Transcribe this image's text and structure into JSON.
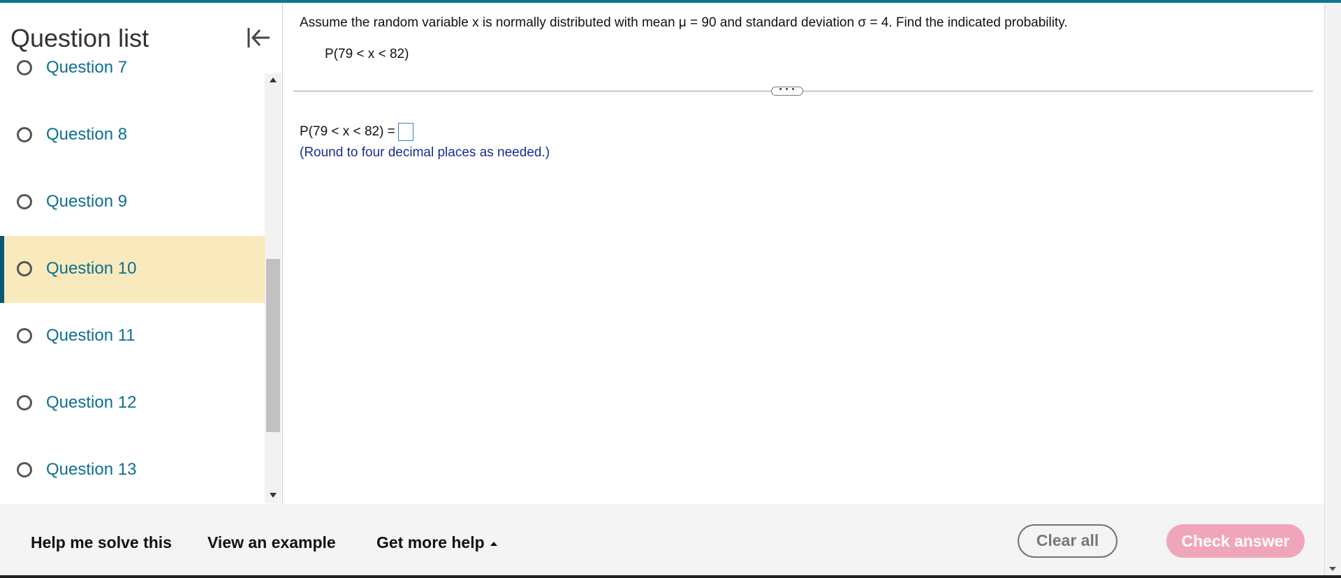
{
  "sidebar": {
    "title": "Question list",
    "collapse_icon": "collapse-left-icon",
    "items": [
      {
        "label": "Question 7"
      },
      {
        "label": "Question 8"
      },
      {
        "label": "Question 9"
      },
      {
        "label": "Question 10",
        "active": true
      },
      {
        "label": "Question 11"
      },
      {
        "label": "Question 12"
      },
      {
        "label": "Question 13"
      }
    ]
  },
  "question": {
    "text": "Assume the random variable x is normally distributed with mean μ = 90 and standard deviation σ = 4. Find the indicated probability.",
    "expression": "P(79 < x < 82)",
    "answer_prefix": "P(79 < x < 82) =",
    "answer_value": "",
    "hint": "(Round to four decimal places as needed.)",
    "dots": "• • •"
  },
  "footer": {
    "help_me_solve": "Help me solve this",
    "view_example": "View an example",
    "get_more_help": "Get more help",
    "clear_all": "Clear all",
    "check_answer": "Check answer"
  },
  "colors": {
    "accent": "#0e7490",
    "link": "#0e6f8f",
    "active_row": "#f8eabd",
    "check_button": "#f0a6ba",
    "hint_text": "#1a2d8c"
  }
}
